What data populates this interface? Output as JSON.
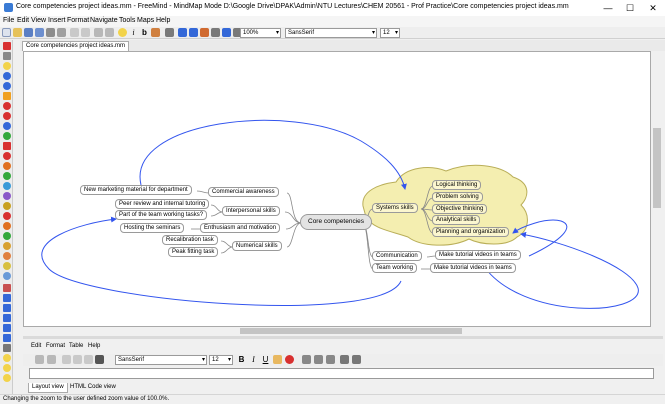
{
  "window": {
    "title": "Core competencies project ideas.mm - FreeMind - MindMap Mode D:\\Google Drive\\DPAK\\Admin\\NTU Lectures\\CHEM 20561 - Prof Practice\\Core competencies project ideas.mm",
    "minimize": "—",
    "maximize": "☐",
    "close": "✕"
  },
  "menubar": [
    "File",
    "Edit",
    "View",
    "Insert",
    "Format",
    "Navigate",
    "Tools",
    "Maps",
    "Help"
  ],
  "toolbar": {
    "zoom": "100%",
    "font": "SansSerif",
    "size": "12"
  },
  "map_tab": "Core competencies project ideas.mm",
  "mindmap": {
    "root": "Core competencies",
    "left_nodes": {
      "commercial": "Commercial awareness",
      "interpersonal": "Interpersonal skills",
      "enthusiasm": "Enthusiasm and motivation",
      "numerical": "Numerical skills",
      "marketing": "New marketing material for department",
      "peer_review": "Peer review and internal tutoring",
      "team_tasks": "Part of the team working tasks?",
      "seminars": "Hosting the seminars",
      "recalibration": "Recalibration task",
      "peak_fitting": "Peak fitting task"
    },
    "right_nodes": {
      "systems": "Systems skills",
      "logical": "Logical thinking",
      "problem": "Problem solving",
      "objective": "Objective thinking",
      "analytical": "Analytical skills",
      "planning": "Planning and organization",
      "communication": "Communication",
      "teamwork": "Team working",
      "tutorial1": "Make tutorial videos in teams",
      "tutorial2": "Make tutorial videos in teams"
    }
  },
  "note_editor": {
    "menu": [
      "Edit",
      "Format",
      "Table",
      "Help"
    ],
    "font": "SansSerif",
    "size": "12",
    "tabs": [
      "Layout view",
      "HTML Code view"
    ]
  },
  "status": "Changing the zoom to the user defined zoom value of 100.0%.",
  "colors": {
    "accent": "#3355ee",
    "cloud": "#f4eeb0",
    "cloud_border": "#b9ae58",
    "node_border": "#9a9a9a"
  }
}
